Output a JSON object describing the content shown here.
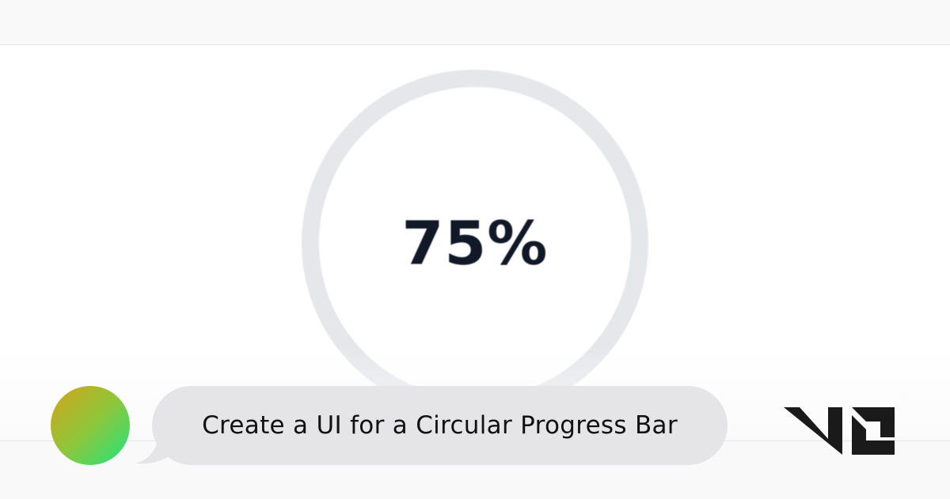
{
  "progress": {
    "percent": 75,
    "label": "75%",
    "track_color": "#e5e7eb"
  },
  "chat": {
    "message": "Create a UI for a Circular Progress Bar",
    "bubble_color": "#e5e5e7"
  },
  "avatar": {
    "gradient": [
      "#d4a419",
      "#1fe57f"
    ]
  },
  "brand": {
    "logo_icon": "v0-logo-icon",
    "color": "#1a1a1a"
  }
}
